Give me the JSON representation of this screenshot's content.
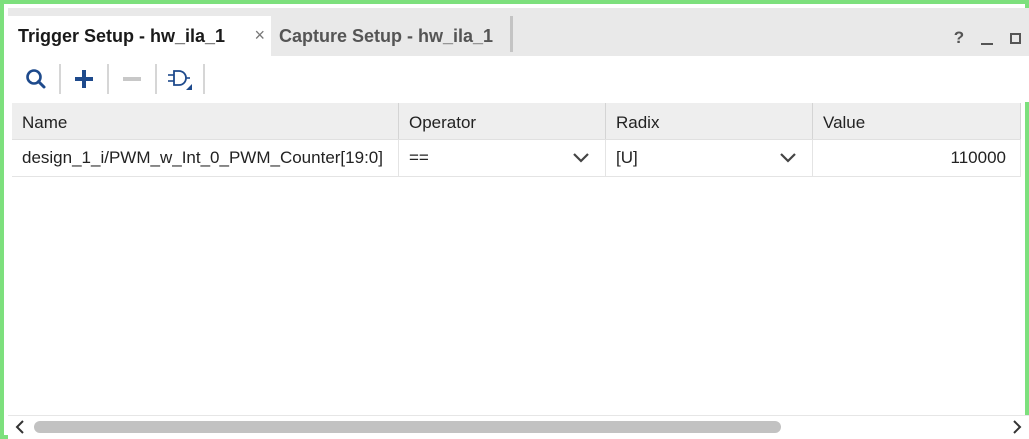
{
  "tabs": [
    {
      "label": "Trigger Setup - hw_ila_1",
      "active": true,
      "close": "×"
    },
    {
      "label": "Capture Setup - hw_ila_1",
      "active": false
    }
  ],
  "window_controls": {
    "help": "?"
  },
  "toolbar": {
    "icons": [
      "search-icon",
      "add-icon",
      "remove-icon",
      "trigger-condition-icon"
    ]
  },
  "table": {
    "columns": [
      "Name",
      "Operator",
      "Radix",
      "Value"
    ],
    "rows": [
      {
        "name": "design_1_i/PWM_w_Int_0_PWM_Counter[19:0]",
        "operator": "==",
        "radix": "[U]",
        "value": "110000"
      }
    ]
  },
  "scrollbar": {
    "thumb_fraction": 0.77
  },
  "colors": {
    "frame_border": "#7de07d",
    "icon_blue": "#1e4a8c",
    "icon_disabled": "#c8c8c8"
  }
}
